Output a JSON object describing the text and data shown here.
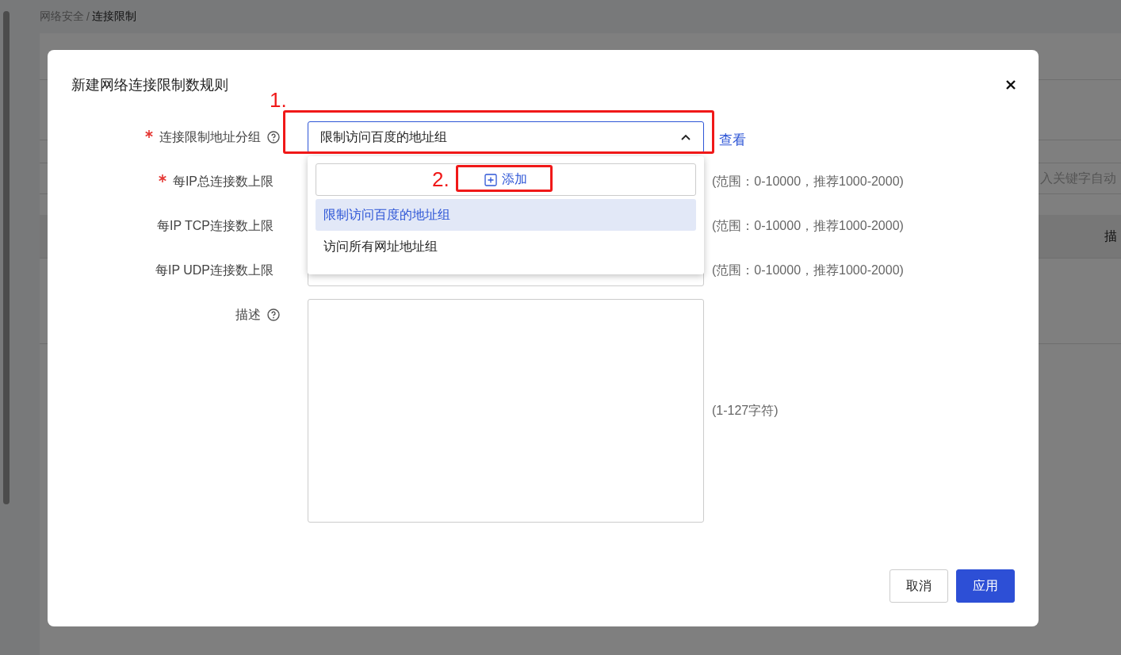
{
  "background": {
    "breadcrumb": [
      {
        "label": "网络安全",
        "current": false
      },
      {
        "label": "/",
        "current": false
      },
      {
        "label": "连接限制",
        "current": true
      }
    ],
    "search": {
      "placeholder": "入关键字自动"
    },
    "table": {
      "columns": [
        "描"
      ]
    }
  },
  "dialog": {
    "title": "新建网络连接限制数规则",
    "fields": [
      {
        "kind": "select",
        "label": "连接限制地址分组",
        "required": true,
        "help": true,
        "value": "限制访问百度的地址组",
        "expanded": true,
        "link": "查看"
      },
      {
        "kind": "number",
        "label": "每IP总连接数上限",
        "required": true,
        "help": false,
        "hint": "(范围：0-10000，推荐1000-2000)"
      },
      {
        "kind": "number",
        "label": "每IP TCP连接数上限",
        "required": false,
        "help": false,
        "hint": "(范围：0-10000，推荐1000-2000)"
      },
      {
        "kind": "number",
        "label": "每IP UDP连接数上限",
        "required": false,
        "help": false,
        "hint": "(范围：0-10000，推荐1000-2000)"
      },
      {
        "kind": "textarea",
        "label": "描述",
        "required": false,
        "help": true,
        "hint": "(1-127字符)"
      }
    ],
    "dropdown": {
      "add_label": "添加",
      "options": [
        {
          "label": "限制访问百度的地址组",
          "selected": true
        },
        {
          "label": "访问所有网址地址组",
          "selected": false
        }
      ]
    },
    "buttons": [
      {
        "label": "取消",
        "kind": "default"
      },
      {
        "label": "应用",
        "kind": "primary"
      }
    ]
  },
  "annotations": [
    {
      "label": "1."
    },
    {
      "label": "2."
    }
  ]
}
